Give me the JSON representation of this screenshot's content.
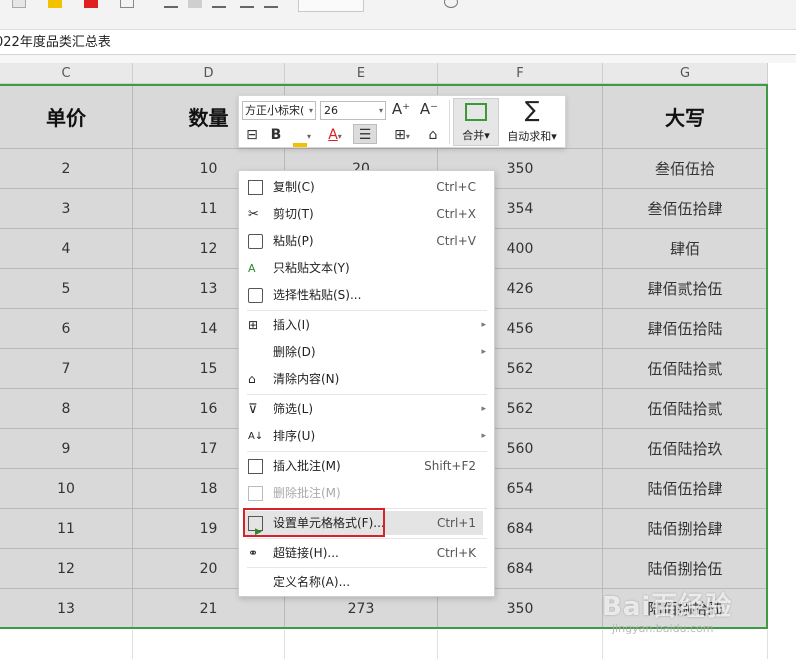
{
  "formula_bar": {
    "text": "022年度品类汇总表"
  },
  "columns": [
    "C",
    "D",
    "E",
    "F",
    "G"
  ],
  "table": {
    "headers": [
      "单价",
      "数量",
      "",
      "",
      "大写"
    ],
    "rows": [
      [
        "2",
        "10",
        "20",
        "350",
        "叁佰伍拾"
      ],
      [
        "3",
        "11",
        "",
        "354",
        "叁佰伍拾肆"
      ],
      [
        "4",
        "12",
        "",
        "400",
        "肆佰"
      ],
      [
        "5",
        "13",
        "",
        "426",
        "肆佰贰拾伍"
      ],
      [
        "6",
        "14",
        "",
        "456",
        "肆佰伍拾陆"
      ],
      [
        "7",
        "15",
        "",
        "562",
        "伍佰陆拾贰"
      ],
      [
        "8",
        "16",
        "",
        "562",
        "伍佰陆拾贰"
      ],
      [
        "9",
        "17",
        "",
        "560",
        "伍佰陆拾玖"
      ],
      [
        "10",
        "18",
        "",
        "654",
        "陆佰伍拾肆"
      ],
      [
        "11",
        "19",
        "",
        "684",
        "陆佰捌拾肆"
      ],
      [
        "12",
        "20",
        "",
        "684",
        "陆佰捌拾伍"
      ],
      [
        "13",
        "21",
        "273",
        "350",
        "陆佰捌拾陆"
      ]
    ]
  },
  "mini_toolbar": {
    "font_name": "方正小标宋(",
    "font_size": "26",
    "grow_font": "A⁺",
    "shrink_font": "A⁻",
    "bold": "B",
    "merge_label": "合并",
    "autosum_label": "自动求和"
  },
  "context_menu": {
    "items": [
      {
        "label": "复制(C)",
        "shortcut": "Ctrl+C"
      },
      {
        "label": "剪切(T)",
        "shortcut": "Ctrl+X"
      },
      {
        "label": "粘贴(P)",
        "shortcut": "Ctrl+V"
      },
      {
        "label": "只粘贴文本(Y)",
        "shortcut": ""
      },
      {
        "label": "选择性粘贴(S)...",
        "shortcut": ""
      },
      {
        "label": "插入(I)",
        "shortcut": ""
      },
      {
        "label": "删除(D)",
        "shortcut": ""
      },
      {
        "label": "清除内容(N)",
        "shortcut": ""
      },
      {
        "label": "筛选(L)",
        "shortcut": ""
      },
      {
        "label": "排序(U)",
        "shortcut": ""
      },
      {
        "label": "插入批注(M)",
        "shortcut": "Shift+F2"
      },
      {
        "label": "删除批注(M)",
        "shortcut": ""
      },
      {
        "label": "设置单元格格式(F)...",
        "shortcut": "Ctrl+1"
      },
      {
        "label": "超链接(H)...",
        "shortcut": "Ctrl+K"
      },
      {
        "label": "定义名称(A)...",
        "shortcut": ""
      }
    ]
  },
  "watermark": {
    "main": "Bai百经验",
    "sub": "jingyan.baidu.com"
  },
  "colors": {
    "selection_border": "#3f9a45",
    "highlight_box": "#d6222b",
    "cell_fill": "#d9d9d9"
  }
}
